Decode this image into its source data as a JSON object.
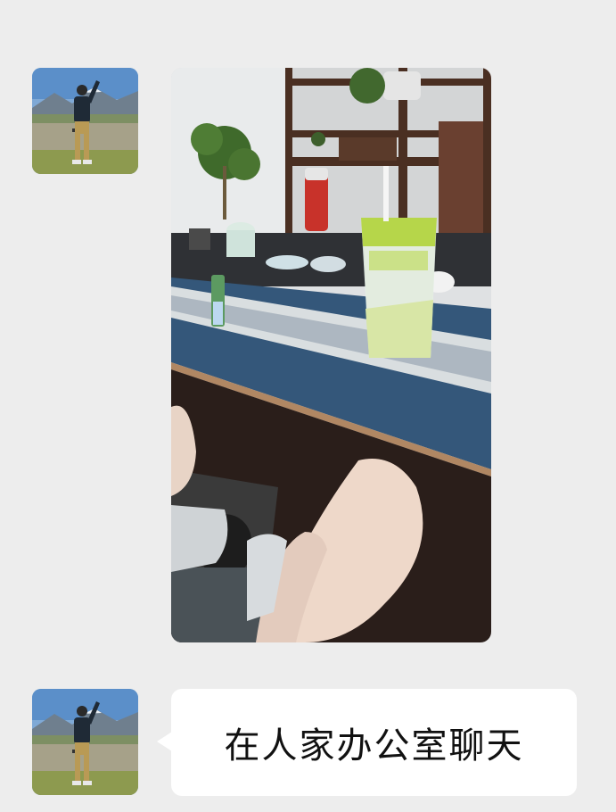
{
  "chat": {
    "messages": [
      {
        "type": "image",
        "sender": "contact",
        "avatar_icon": "person-landscape-avatar-icon",
        "image_icon": "office-tea-table-photo-icon"
      },
      {
        "type": "text",
        "sender": "contact",
        "avatar_icon": "person-landscape-avatar-icon",
        "text": "在人家办公室聊天"
      }
    ]
  },
  "colors": {
    "background": "#ededed",
    "bubble": "#ffffff",
    "text": "#111111"
  }
}
